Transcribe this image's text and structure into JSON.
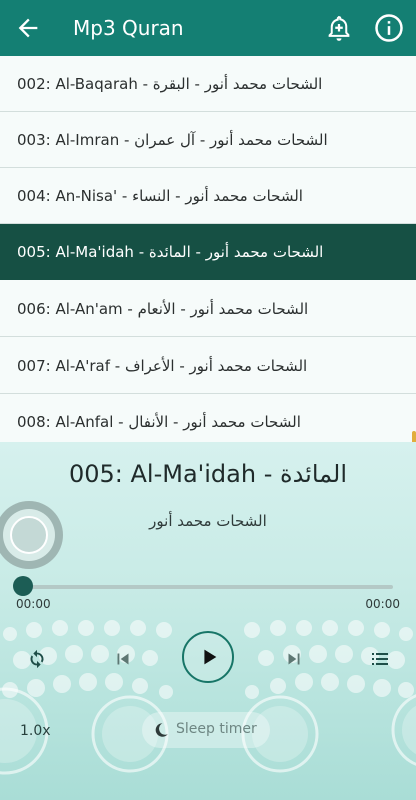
{
  "appbar": {
    "title": "Mp3 Quran",
    "back_icon": "arrow-left-icon",
    "add_alarm_icon": "bell-plus-icon",
    "info_icon": "info-icon"
  },
  "colors": {
    "appbar": "#147f73",
    "selected_row": "#165044",
    "accent": "#1c5d55",
    "player_bg": "#c8ebe6",
    "scroll_indicator": "#e1ad3d"
  },
  "tracks": [
    {
      "label": "002: Al-Baqarah - الشحات محمد أنور  -  البقرة",
      "selected": false
    },
    {
      "label": "003: Al-Imran - الشحات محمد أنور  -  آل عمران",
      "selected": false
    },
    {
      "label": "004: An-Nisa' - الشحات محمد أنور  -  النساء",
      "selected": false
    },
    {
      "label": "005: Al-Ma'idah - الشحات محمد أنور  -  المائدة",
      "selected": true
    },
    {
      "label": "006: Al-An'am - الشحات محمد أنور  -  الأنعام",
      "selected": false
    },
    {
      "label": "007: Al-A'raf - الشحات محمد أنور  -  الأعراف",
      "selected": false
    },
    {
      "label": "008: Al-Anfal - الشحات محمد أنور  -  الأنفال",
      "selected": false
    }
  ],
  "player": {
    "now_playing_title": "005: Al-Ma'idah - المائدة",
    "artist": "الشحات محمد أنور",
    "elapsed": "00:00",
    "duration": "00:00",
    "progress": 0,
    "speed": "1.0x",
    "sleep_timer_label": "Sleep timer",
    "icons": [
      "repeat-icon",
      "skip-previous-icon",
      "play-icon",
      "skip-next-icon",
      "playlist-icon",
      "moon-icon",
      "disc-icon"
    ]
  }
}
